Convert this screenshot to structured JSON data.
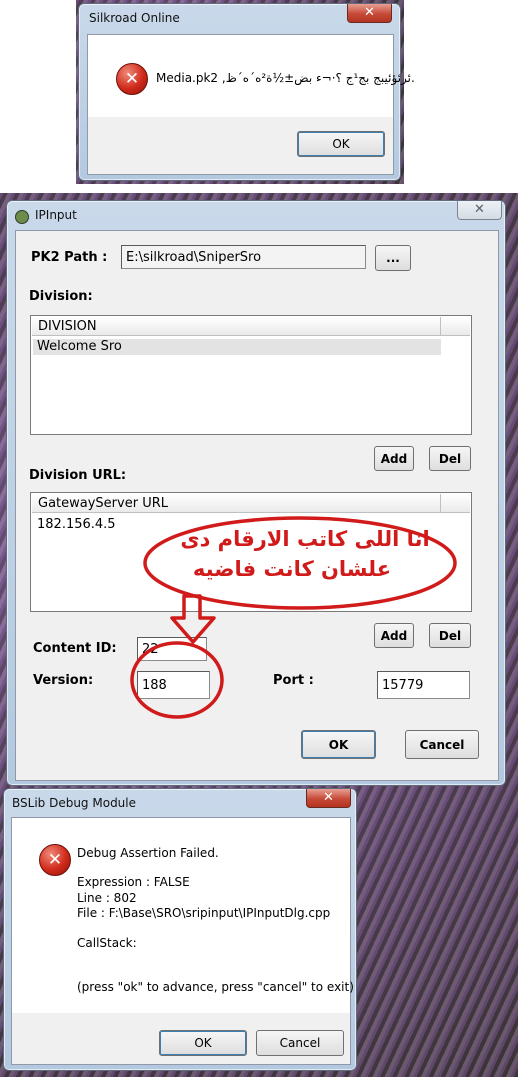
{
  "dialog_silkroad": {
    "title": "Silkroad Online",
    "close_glyph": "✕",
    "icon": "error-icon",
    "message": "Media.pk2 ,ئرئؤئ‍يبج بج¹ج ؟·¬ء بض±½ة²ه´ه´ظ.",
    "ok_label": "OK"
  },
  "dialog_ipinput": {
    "title": "IPInput",
    "close_glyph": "✕",
    "pk2_label": "PK2 Path :",
    "pk2_value": "E:\\silkroad\\SniperSro",
    "browse_label": "...",
    "division_label": "Division:",
    "division_list": {
      "column_header": "DIVISION",
      "rows": [
        "Welcome Sro"
      ]
    },
    "add_label": "Add",
    "del_label": "Del",
    "division_url_label": "Division URL:",
    "url_list": {
      "column_header": "GatewayServer URL",
      "rows": [
        "182.156.4.5"
      ]
    },
    "content_id_label": "Content ID:",
    "content_id_value": "22",
    "version_label": "Version:",
    "version_value": "188",
    "port_label": "Port :",
    "port_value": "15779",
    "ok_label": "OK",
    "cancel_label": "Cancel"
  },
  "annotation": {
    "line1": "انا اللى كاتب الارقام دى",
    "line2": "علشان كانت فاضيه",
    "color": "#d11a1a"
  },
  "dialog_debug": {
    "title": "BSLib Debug Module",
    "close_glyph": "✕",
    "icon": "error-icon",
    "heading": "Debug Assertion Failed.",
    "expression": "Expression : FALSE",
    "line": "Line : 802",
    "file": "File : F:\\Base\\SRO\\sripinput\\IPInputDlg.cpp",
    "callstack": "CallStack:",
    "hint": "(press \"ok\" to advance, press \"cancel\" to exit)",
    "ok_label": "OK",
    "cancel_label": "Cancel"
  },
  "colors": {
    "window_frame": "#b4c9e0",
    "close_button": "#c74a38",
    "dialog_face": "#f0f0f0",
    "error_icon": "#d02a1a"
  }
}
